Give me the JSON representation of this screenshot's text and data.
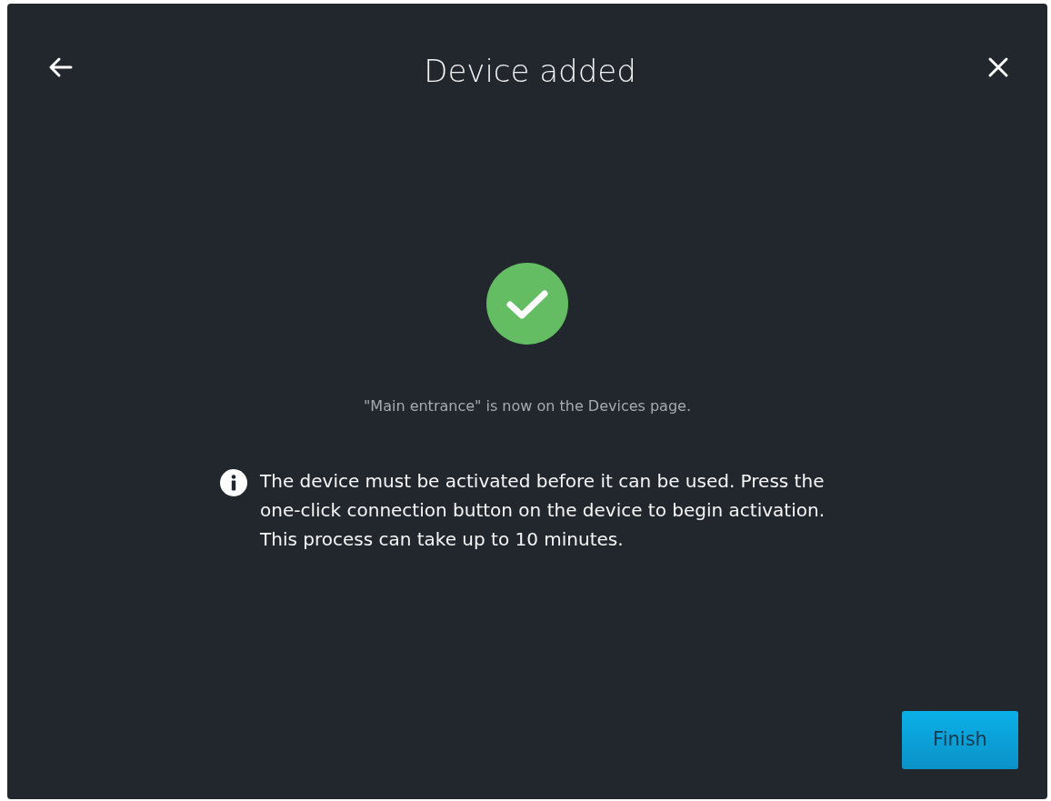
{
  "dialog": {
    "title": "Device added"
  },
  "status": {
    "kind": "success",
    "message": "\"Main entrance\" is now on the Devices page."
  },
  "info": {
    "text": "The device must be activated before it can be used. Press the one-click connection button on the device to begin activation. This process can take up to 10 minutes."
  },
  "buttons": [
    {
      "label": "Finish",
      "kind": "primary"
    }
  ]
}
